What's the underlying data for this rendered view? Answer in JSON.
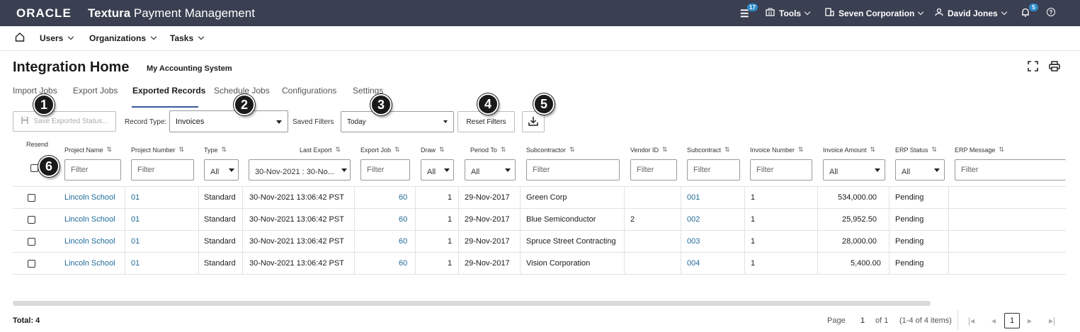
{
  "topbar": {
    "brand": "ORACLE",
    "app_bold": "Textura",
    "app_rest": " Payment Management",
    "tasks_badge": "17",
    "tools_label": "Tools",
    "org_label": "Seven Corporation",
    "user_label": "David Jones",
    "notif_badge": "5"
  },
  "nav": {
    "users": "Users",
    "organizations": "Organizations",
    "tasks": "Tasks"
  },
  "page": {
    "title": "Integration Home",
    "subtitle": "My Accounting System"
  },
  "tabs": [
    "Import Jobs",
    "Export Jobs",
    "Exported Records",
    "Schedule Jobs",
    "Configurations",
    "Settings"
  ],
  "toolbar": {
    "save_status": "Save Exported Status...",
    "record_type_label": "Record Type:",
    "record_type_value": "Invoices",
    "saved_filters_label": "Saved Filters",
    "saved_filters_value": "Today",
    "reset_filters": "Reset Filters"
  },
  "callouts": [
    "1",
    "2",
    "3",
    "4",
    "5",
    "6"
  ],
  "table": {
    "resend_label": "Resend",
    "headers": [
      "Project Name",
      "Project Number",
      "Type",
      "Last Export",
      "Export Job",
      "Draw",
      "Period To",
      "Subcontractor",
      "Vendor ID",
      "Subcontract",
      "Invoice Number",
      "Invoice Amount",
      "ERP Status",
      "ERP Message"
    ],
    "filter_placeholder": "Filter",
    "filter_all": "All",
    "last_export_filter": "30-Nov-2021 : 30-No...",
    "rows": [
      {
        "project_name": "Lincoln School",
        "project_number": "01",
        "type": "Standard",
        "last_export": "30-Nov-2021 13:06:42 PST",
        "export_job": "60",
        "draw": "1",
        "period_to": "29-Nov-2017",
        "subcontractor": "Green Corp",
        "vendor_id": "",
        "subcontract": "001",
        "invoice_number": "1",
        "invoice_amount": "534,000.00",
        "erp_status": "Pending"
      },
      {
        "project_name": "Lincoln School",
        "project_number": "01",
        "type": "Standard",
        "last_export": "30-Nov-2021 13:06:42 PST",
        "export_job": "60",
        "draw": "1",
        "period_to": "29-Nov-2017",
        "subcontractor": "Blue Semiconductor",
        "vendor_id": "2",
        "subcontract": "002",
        "invoice_number": "1",
        "invoice_amount": "25,952.50",
        "erp_status": "Pending"
      },
      {
        "project_name": "Lincoln School",
        "project_number": "01",
        "type": "Standard",
        "last_export": "30-Nov-2021 13:06:42 PST",
        "export_job": "60",
        "draw": "1",
        "period_to": "29-Nov-2017",
        "subcontractor": "Spruce Street Contracting",
        "vendor_id": "",
        "subcontract": "003",
        "invoice_number": "1",
        "invoice_amount": "28,000.00",
        "erp_status": "Pending"
      },
      {
        "project_name": "Lincoln School",
        "project_number": "01",
        "type": "Standard",
        "last_export": "30-Nov-2021 13:06:42 PST",
        "export_job": "60",
        "draw": "1",
        "period_to": "29-Nov-2017",
        "subcontractor": "Vision Corporation",
        "vendor_id": "",
        "subcontract": "004",
        "invoice_number": "1",
        "invoice_amount": "5,400.00",
        "erp_status": "Pending"
      }
    ]
  },
  "footer": {
    "total": "Total: 4",
    "page_label": "Page",
    "page_current": "1",
    "page_of": "of 1",
    "items": "(1-4 of 4 items)"
  }
}
